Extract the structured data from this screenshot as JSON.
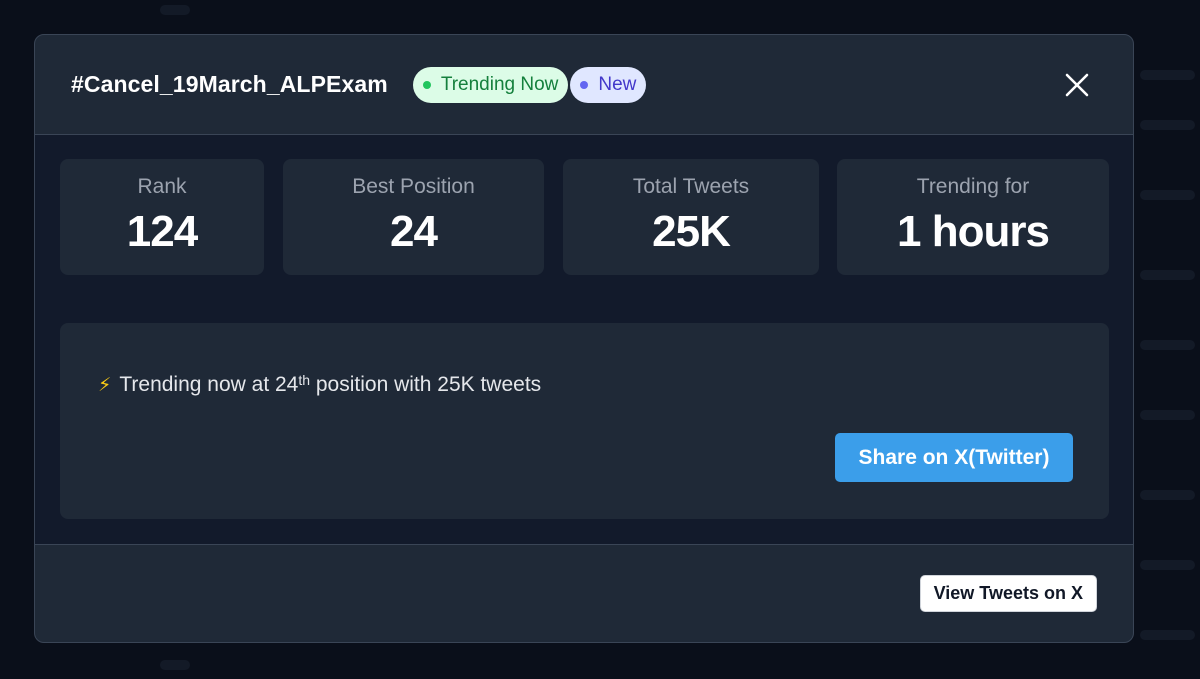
{
  "modal": {
    "title": "#Cancel_19March_ALPExam",
    "badges": {
      "trending": "Trending Now",
      "new": "New"
    }
  },
  "stats": [
    {
      "label": "Rank",
      "value": "124"
    },
    {
      "label": "Best Position",
      "value": "24"
    },
    {
      "label": "Total Tweets",
      "value": "25K"
    },
    {
      "label": "Trending for",
      "value": "1 hours"
    }
  ],
  "share": {
    "icon": "lightning-bolt-icon",
    "text_prefix": "Trending now at 24",
    "ordinal_suffix": "th",
    "text_suffix": " position with 25K tweets",
    "button_label": "Share on X(Twitter)"
  },
  "footer": {
    "view_button_label": "View Tweets on X"
  },
  "colors": {
    "modal_bg": "#1f2937",
    "body_bg": "#121a2b",
    "accent_blue": "#3b9eea",
    "trending_badge_bg": "#dcfce7",
    "trending_badge_text": "#15803d",
    "new_badge_bg": "#e0e7ff",
    "new_badge_text": "#4338ca"
  }
}
